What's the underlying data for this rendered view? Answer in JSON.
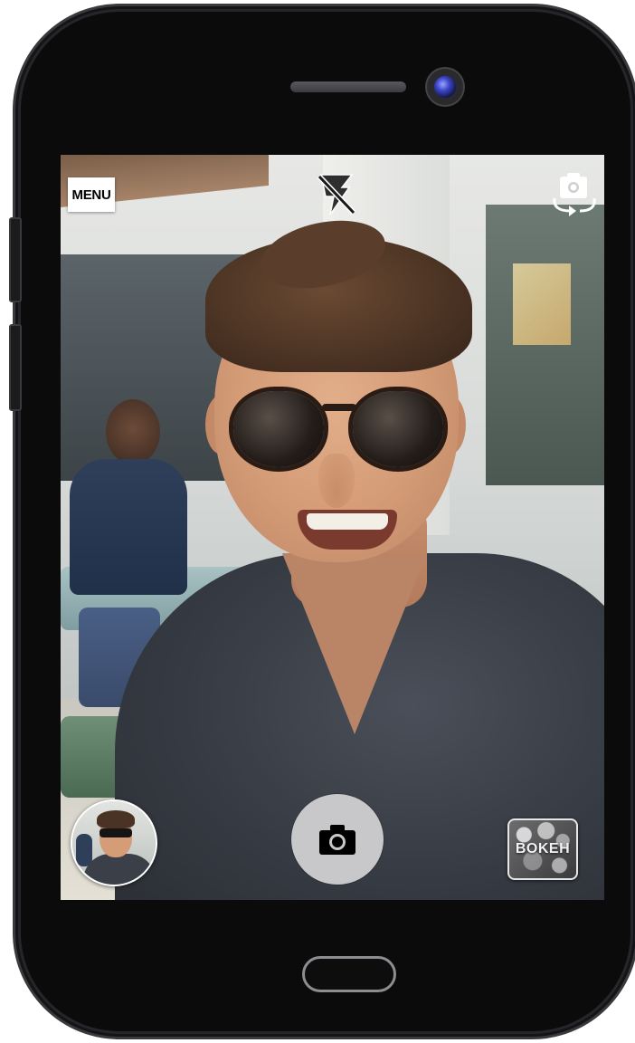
{
  "camera_app": {
    "menu_label": "MENU",
    "bokeh_label": "BOKEH",
    "flash_icon": "flash-off-icon",
    "switch_camera_icon": "switch-camera-icon",
    "shutter_icon": "camera-icon",
    "gallery_icon": "gallery-thumbnail"
  },
  "colors": {
    "phone_body": "#0b0b0c",
    "shutter": "#c8c8ca",
    "menu_bg": "#ffffff",
    "camera_lens": "#3b45c8"
  }
}
